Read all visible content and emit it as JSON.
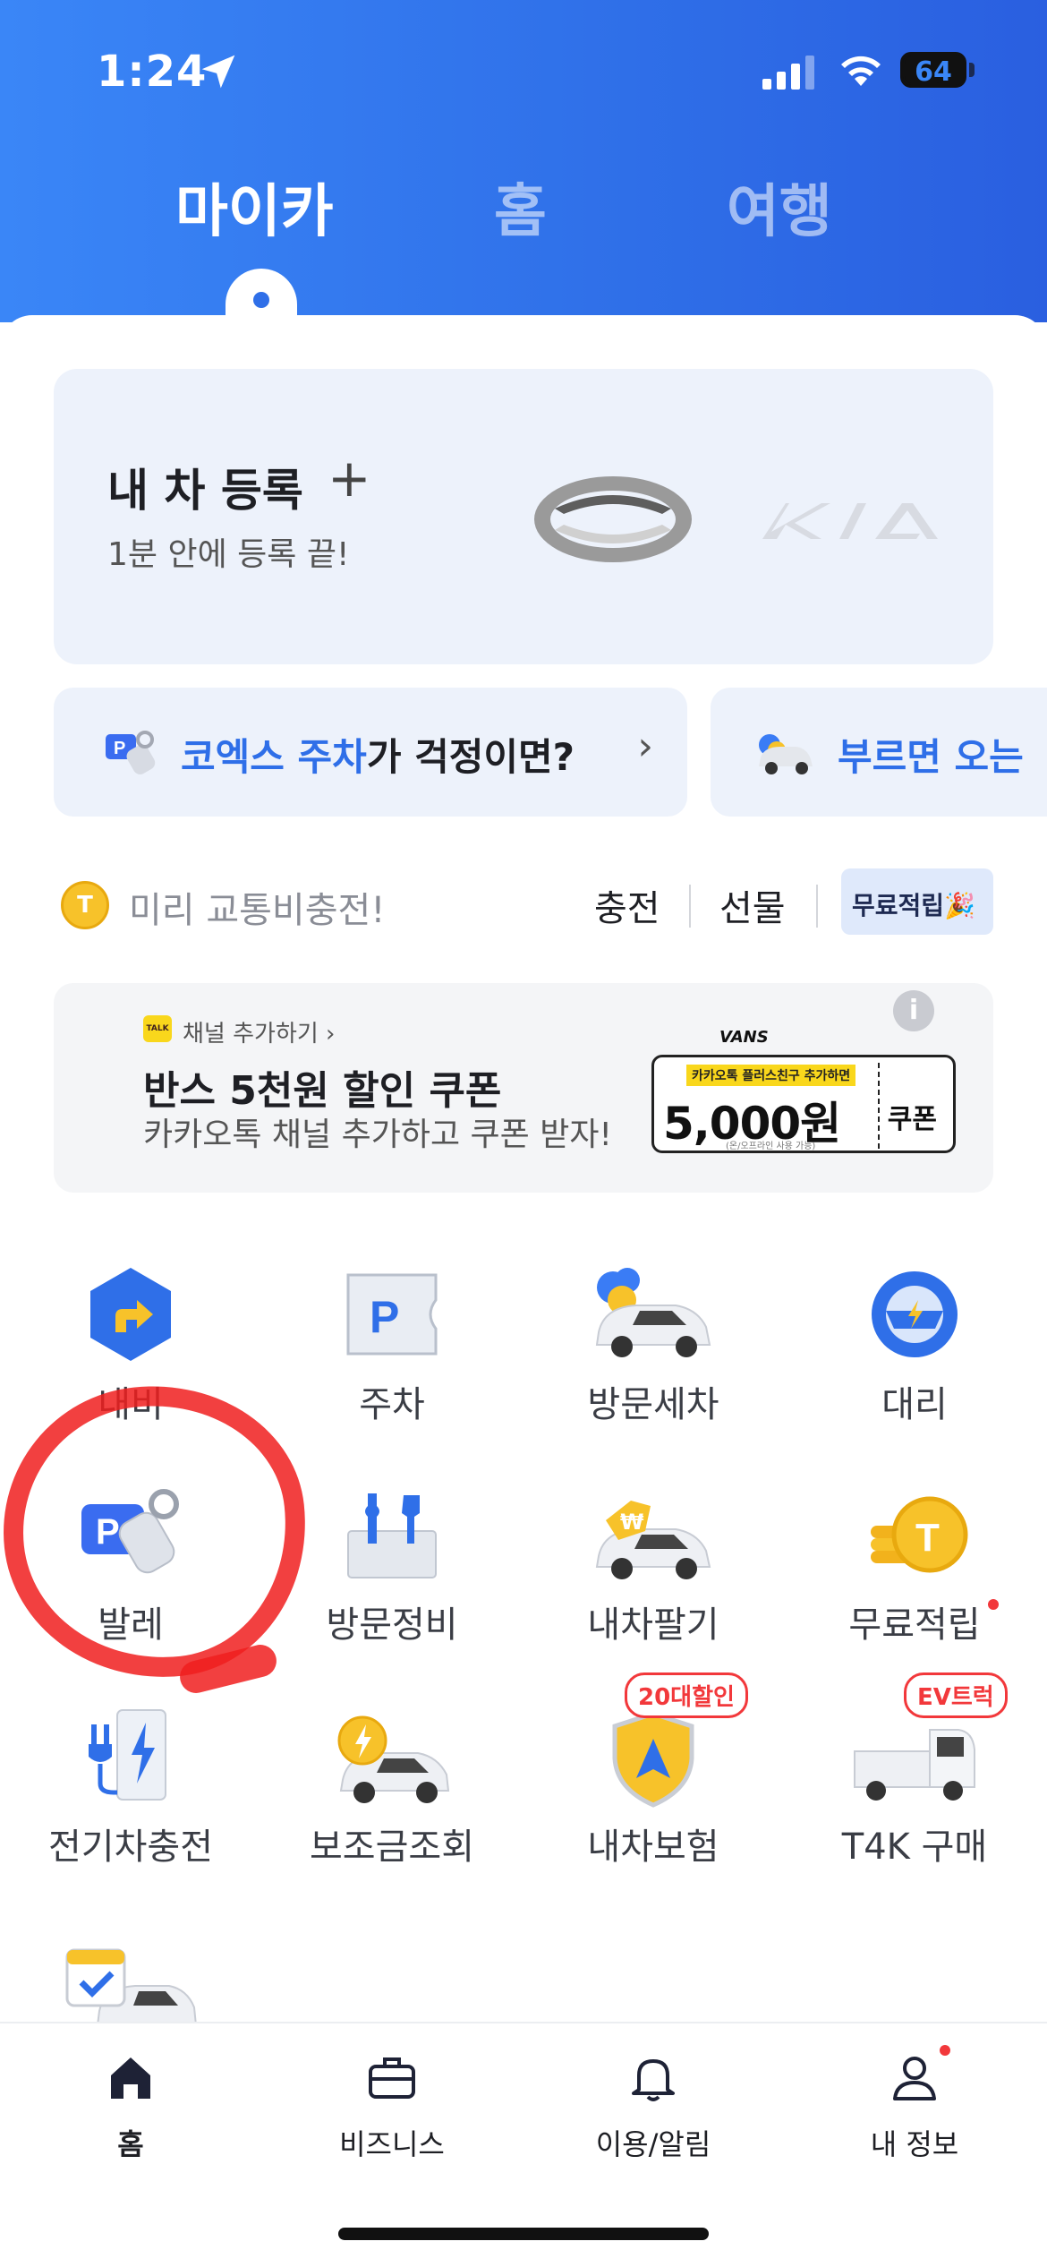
{
  "status_bar": {
    "time": "1:24",
    "battery": "64"
  },
  "top_tabs": [
    {
      "label": "마이카",
      "active": true
    },
    {
      "label": "홈",
      "active": false
    },
    {
      "label": "여행",
      "active": false
    }
  ],
  "register_card": {
    "title": "내 차 등록",
    "plus": "+",
    "subtitle": "1분 안에 등록 끝!"
  },
  "promos": [
    {
      "highlight": "코엑스 주차",
      "rest": "가 걱정이면?",
      "chevron": "›"
    },
    {
      "highlight": "부르면 오는",
      "rest": ""
    }
  ],
  "charge_row": {
    "coin": "T",
    "text": "미리 교통비충전!",
    "buttons": [
      "충전",
      "선물"
    ],
    "free_button": "무료적립🎉"
  },
  "ad_banner": {
    "channel_badge": "TALK",
    "channel": "채널 추가하기 ›",
    "title": "반스 5천원 할인 쿠폰",
    "subtitle": "카카오톡 채널 추가하고 쿠폰 받자!",
    "info": "i",
    "coupon": {
      "brand": "VANS",
      "top": "카카오톡 플러스친구 추가하면",
      "amount": "5,000원",
      "label": "쿠폰",
      "fine": "(온/오프라인 사용 가능)"
    }
  },
  "services": [
    {
      "label": "내비",
      "icon": "navigation-icon"
    },
    {
      "label": "주차",
      "icon": "parking-icon"
    },
    {
      "label": "방문세차",
      "icon": "car-wash-icon"
    },
    {
      "label": "대리",
      "icon": "steering-wheel-icon"
    },
    {
      "label": "발레",
      "icon": "valet-icon"
    },
    {
      "label": "방문정비",
      "icon": "toolbox-icon"
    },
    {
      "label": "내차팔기",
      "icon": "sell-car-icon",
      "badge": ""
    },
    {
      "label": "무료적립",
      "icon": "coin-stack-icon",
      "dot": true
    },
    {
      "label": "전기차충전",
      "icon": "ev-charger-icon"
    },
    {
      "label": "보조금조회",
      "icon": "subsidy-car-icon"
    },
    {
      "label": "내차보험",
      "icon": "insurance-shield-icon",
      "badge": "20대할인"
    },
    {
      "label": "T4K 구매",
      "icon": "truck-icon",
      "badge": "EV트럭"
    },
    {
      "label": "",
      "icon": "calendar-car-icon"
    }
  ],
  "bottom_nav": [
    {
      "label": "홈",
      "icon": "home-icon",
      "active": true
    },
    {
      "label": "비즈니스",
      "icon": "briefcase-icon",
      "active": false
    },
    {
      "label": "이용/알림",
      "icon": "bell-icon",
      "active": false
    },
    {
      "label": "내 정보",
      "icon": "person-icon",
      "active": false,
      "dot": true
    }
  ],
  "colors": {
    "primary": "#2f6fe8",
    "header_start": "#3a86f7",
    "annotation": "#f01e1e",
    "badge_red": "#f2383b"
  }
}
